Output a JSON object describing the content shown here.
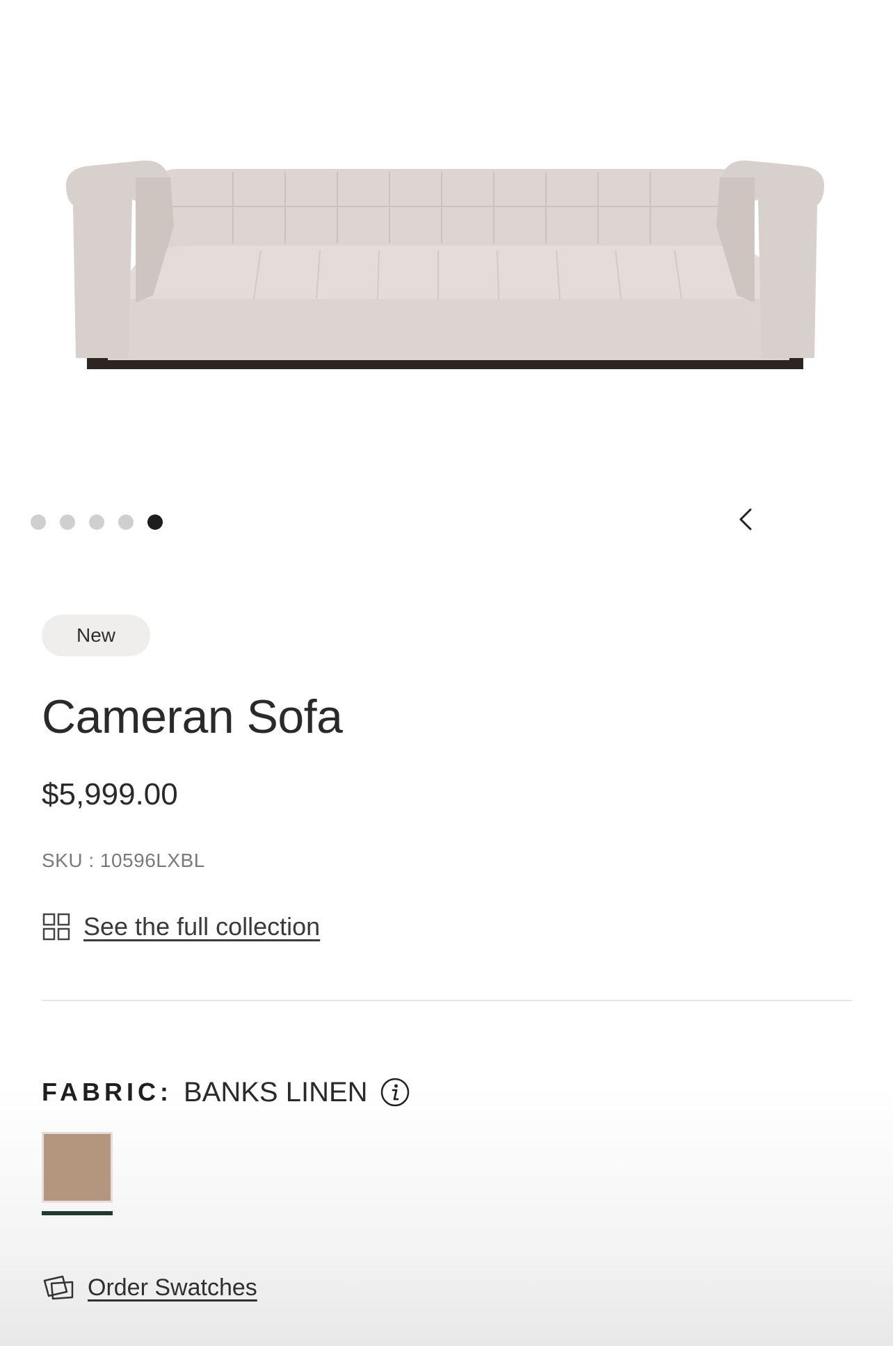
{
  "gallery": {
    "image_alt": "Cameran Sofa",
    "dots_count": 5,
    "active_dot_index": 4
  },
  "product": {
    "badge": "New",
    "title": "Cameran Sofa",
    "price": "$5,999.00",
    "sku": "SKU : 10596LXBL",
    "collection_link": "See the full collection"
  },
  "fabric": {
    "label": "FABRIC:",
    "value": "BANKS LINEN",
    "swatch_color": "#b4967e",
    "selected_underline_color": "#1f3a32"
  },
  "order_swatches": "Order Swatches",
  "icons": {
    "prev": "chevron-left-icon",
    "collection": "grid-icon",
    "info": "info-icon",
    "swatches": "swatches-icon"
  }
}
